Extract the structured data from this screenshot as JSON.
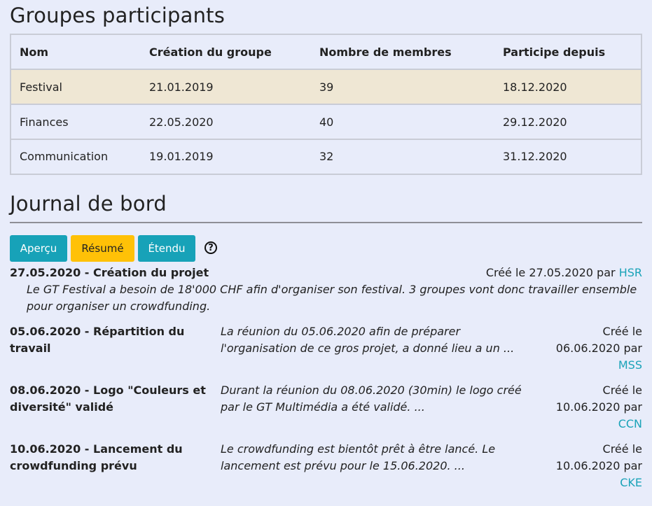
{
  "groups": {
    "title": "Groupes participants",
    "columns": [
      "Nom",
      "Création du groupe",
      "Nombre de membres",
      "Participe depuis"
    ],
    "rows": [
      [
        "Festival",
        "21.01.2019",
        "39",
        "18.12.2020"
      ],
      [
        "Finances",
        "22.05.2020",
        "40",
        "29.12.2020"
      ],
      [
        "Communication",
        "19.01.2019",
        "32",
        "31.12.2020"
      ]
    ]
  },
  "journal": {
    "title": "Journal de bord",
    "buttons": {
      "apercu": "Aperçu",
      "resume": "Résumé",
      "etendu": "Étendu"
    },
    "help": "?",
    "entries": [
      {
        "title": "27.05.2020 - Création du projet",
        "description": "Le GT Festival a besoin de 18'000 CHF afin d'organiser son festival. 3 groupes vont donc travailler ensemble pour organiser un crowdfunding.",
        "created_prefix": "Créé le 27.05.2020 par",
        "author": "HSR"
      },
      {
        "title": "05.06.2020 - Répartition du travail",
        "description": "La réunion du 05.06.2020 afin de préparer l'organisation de ce gros projet, a donné lieu a un ...",
        "created_prefix": "Créé le 06.06.2020 par",
        "author": "MSS"
      },
      {
        "title": "08.06.2020 - Logo \"Couleurs et diversité\" validé",
        "description": "Durant la réunion du 08.06.2020 (30min) le logo créé par le GT Multimédia a été validé. ...",
        "created_prefix": "Créé le 10.06.2020 par",
        "author": "CCN"
      },
      {
        "title": "10.06.2020 - Lancement du crowdfunding prévu",
        "description": "Le crowdfunding est bientôt prêt à être lancé. Le lancement est prévu pour le 15.06.2020. ...",
        "created_prefix": "Créé le 10.06.2020 par",
        "author": "CKE"
      }
    ]
  },
  "colors": {
    "background": "#e8ecfa",
    "highlight_row": "#efe7d4",
    "button_info": "#17a2b8",
    "button_active": "#ffc107",
    "author_link": "#1aa3b8"
  }
}
